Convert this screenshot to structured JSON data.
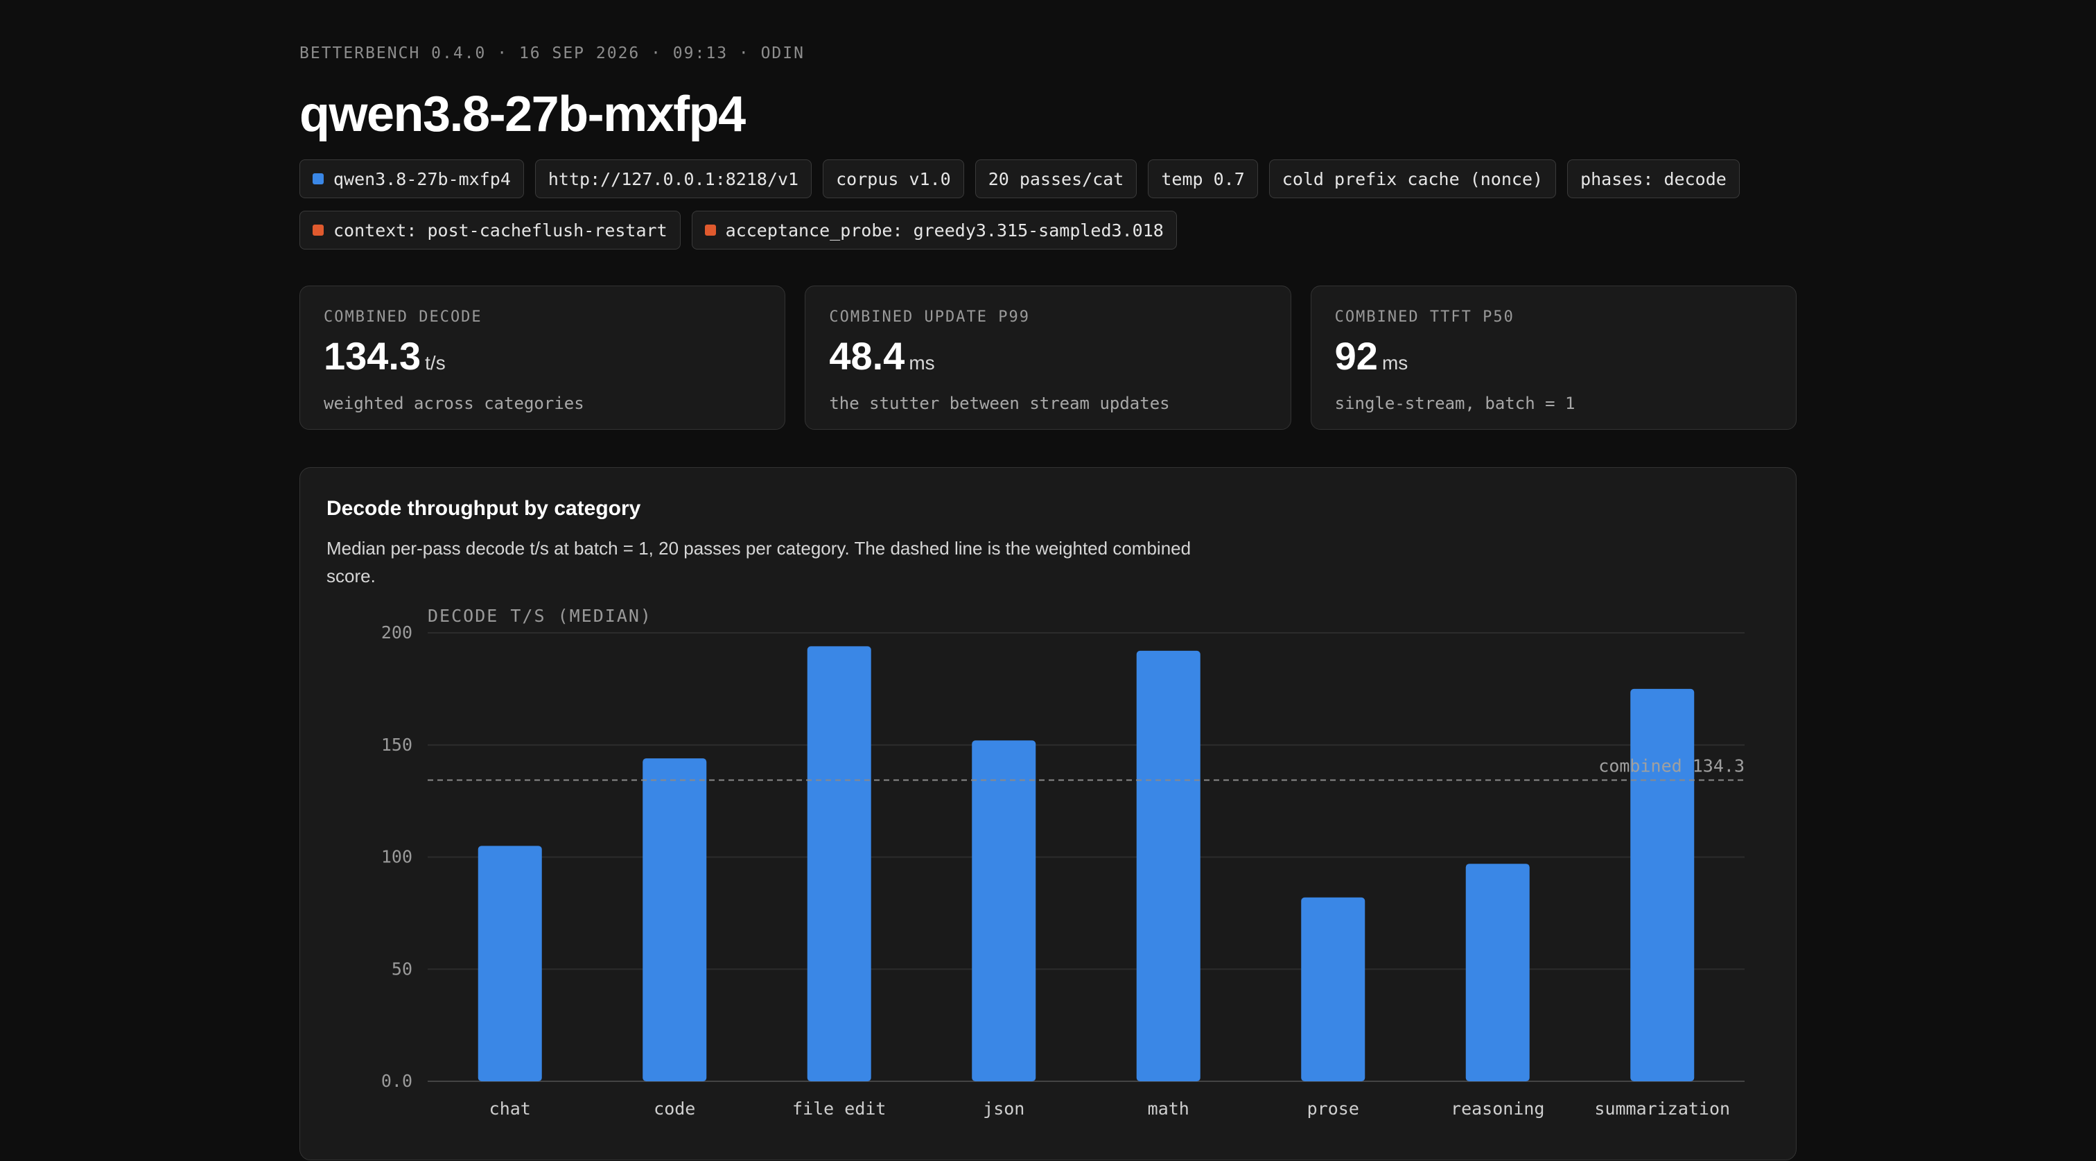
{
  "header": {
    "meta": "BETTERBENCH 0.4.0 · 16 SEP 2026 · 09:13 · ODIN",
    "title": "qwen3.8-27b-mxfp4"
  },
  "tags_row1": [
    {
      "label": "qwen3.8-27b-mxfp4",
      "swatch": "#3a87e6"
    },
    {
      "label": "http://127.0.0.1:8218/v1"
    },
    {
      "label": "corpus v1.0"
    },
    {
      "label": "20 passes/cat"
    },
    {
      "label": "temp 0.7"
    },
    {
      "label": "cold prefix cache (nonce)"
    },
    {
      "label": "phases: decode"
    }
  ],
  "tags_row2": [
    {
      "label": "context: post-cacheflush-restart",
      "swatch": "#e05a2e"
    },
    {
      "label": "acceptance_probe: greedy3.315-sampled3.018",
      "swatch": "#e05a2e"
    }
  ],
  "cards": [
    {
      "label": "COMBINED DECODE",
      "value": "134.3",
      "unit": "t/s",
      "sub": "weighted across categories"
    },
    {
      "label": "COMBINED UPDATE P99",
      "value": "48.4",
      "unit": "ms",
      "sub": "the stutter between stream updates"
    },
    {
      "label": "COMBINED TTFT P50",
      "value": "92",
      "unit": "ms",
      "sub": "single-stream, batch = 1"
    }
  ],
  "panel": {
    "title": "Decode throughput by category",
    "description": "Median per-pass decode t/s at batch = 1, 20 passes per category. The dashed line is the weighted combined score."
  },
  "chart_data": {
    "type": "bar",
    "ylabel": "DECODE T/S (MEDIAN)",
    "ylim": [
      0,
      200
    ],
    "yticks": [
      "0.0",
      "50",
      "100",
      "150",
      "200"
    ],
    "categories": [
      "chat",
      "code",
      "file edit",
      "json",
      "math",
      "prose",
      "reasoning",
      "summarization"
    ],
    "values": [
      105,
      144,
      194,
      152,
      192,
      82,
      97,
      175
    ],
    "reference_line": {
      "label": "combined 134.3",
      "value": 134.3
    },
    "bar_color": "#3a87e6",
    "grid": true
  }
}
